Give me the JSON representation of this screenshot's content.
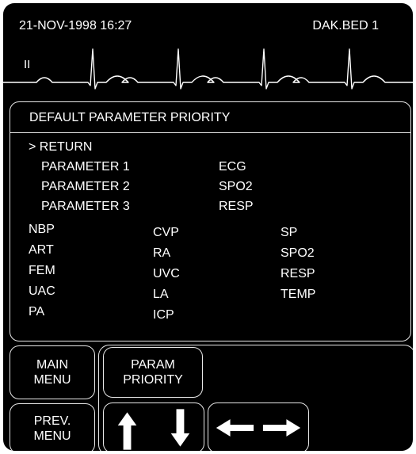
{
  "header": {
    "datetime": "21-NOV-1998  16:27",
    "bed": "DAK.BED 1"
  },
  "waveform": {
    "lead_label": "II",
    "color": "#ffffff"
  },
  "menu": {
    "title": "DEFAULT PARAMETER PRIORITY",
    "return_label": "> RETURN",
    "priorities": [
      {
        "label": "PARAMETER 1",
        "value": "ECG"
      },
      {
        "label": "PARAMETER 2",
        "value": "SPO2"
      },
      {
        "label": "PARAMETER 3",
        "value": "RESP"
      }
    ],
    "options_col1": [
      "NBP",
      "ART",
      "FEM",
      "UAC",
      "PA"
    ],
    "options_col2": [
      "CVP",
      "RA",
      "UVC",
      "LA",
      "ICP"
    ],
    "options_col3": [
      "SP",
      "SPO2",
      "RESP",
      "TEMP"
    ]
  },
  "buttons": {
    "main_menu": "MAIN MENU",
    "prev_menu": "PREV. MENU",
    "param_priority": "PARAM PRIORITY",
    "up_down_icon": "up-down-arrows-icon",
    "left_right_icon": "left-right-arrows-icon"
  },
  "colors": {
    "background": "#000000",
    "foreground": "#ffffff"
  }
}
